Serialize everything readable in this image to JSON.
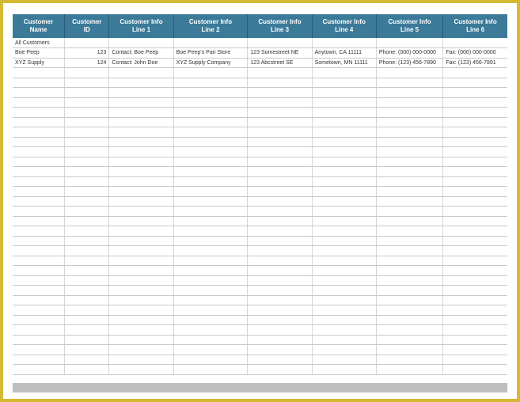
{
  "columns": [
    "Customer\nName",
    "Customer\nID",
    "Customer Info\nLine 1",
    "Customer Info\nLine 2",
    "Customer Info\nLine 3",
    "Customer Info\nLine 4",
    "Customer Info\nLine 5",
    "Customer Info\nLine 6"
  ],
  "rows": [
    {
      "name": "All Customers",
      "id": "",
      "l1": "",
      "l2": "",
      "l3": "",
      "l4": "",
      "l5": "",
      "l6": ""
    },
    {
      "name": "Boe Peep",
      "id": "123",
      "l1": "Contact: Boe Peep",
      "l2": "Boe Peep's Pari Store",
      "l3": "123 Somestreet NE",
      "l4": "Anytown, CA 11111",
      "l5": "Phone: (000) 000-0000",
      "l6": "Fax: (000) 000-0000"
    },
    {
      "name": "XYZ Supply",
      "id": "124",
      "l1": "Contact: John Doe",
      "l2": "XYZ Supply Company",
      "l3": "123 Abcstreet SE",
      "l4": "Sometown, MN 11111",
      "l5": "Phone: (123) 456-7890",
      "l6": "Fax: (123) 456-7891"
    }
  ],
  "empty_row_count": 31,
  "colors": {
    "border": "#d4b933",
    "header_bg": "#3b7a99",
    "header_text": "#ffffff",
    "grid_line": "#c9c9c9"
  }
}
